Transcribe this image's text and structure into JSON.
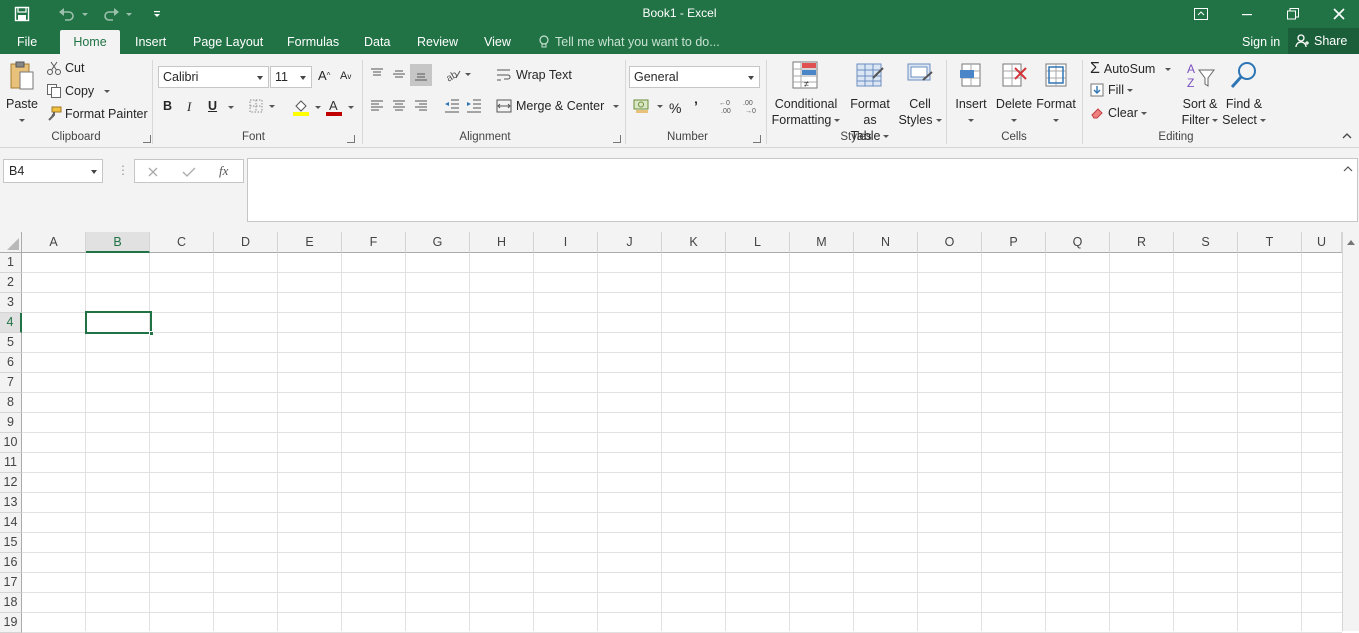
{
  "window": {
    "title": "Book1 - Excel"
  },
  "tabs": [
    "File",
    "Home",
    "Insert",
    "Page Layout",
    "Formulas",
    "Data",
    "Review",
    "View"
  ],
  "active_tab": "Home",
  "tell_me": "Tell me what you want to do...",
  "account": {
    "signin": "Sign in",
    "share": "Share"
  },
  "clipboard": {
    "paste": "Paste",
    "cut": "Cut",
    "copy": "Copy",
    "format_painter": "Format Painter",
    "label": "Clipboard"
  },
  "font": {
    "name": "Calibri",
    "size": "11",
    "bold": "B",
    "italic": "I",
    "underline": "U",
    "label": "Font"
  },
  "alignment": {
    "wrap": "Wrap Text",
    "merge": "Merge & Center",
    "label": "Alignment"
  },
  "number": {
    "format": "General",
    "percent": "%",
    "comma": "’",
    "label": "Number"
  },
  "styles": {
    "cond1": "Conditional",
    "cond2": "Formatting",
    "fat1": "Format as",
    "fat2": "Table",
    "cs1": "Cell",
    "cs2": "Styles",
    "label": "Styles"
  },
  "cells": {
    "insert": "Insert",
    "delete": "Delete",
    "format": "Format",
    "label": "Cells"
  },
  "editing": {
    "autosum": "AutoSum",
    "fill": "Fill",
    "clear": "Clear",
    "sort1": "Sort &",
    "sort2": "Filter",
    "find1": "Find &",
    "find2": "Select",
    "label": "Editing"
  },
  "formula_bar": {
    "namebox": "B4",
    "fx": "fx",
    "value": ""
  },
  "columns": [
    "A",
    "B",
    "C",
    "D",
    "E",
    "F",
    "G",
    "H",
    "I",
    "J",
    "K",
    "L",
    "M",
    "N",
    "O",
    "P",
    "Q",
    "R",
    "S",
    "T",
    "U"
  ],
  "rows": [
    "1",
    "2",
    "3",
    "4",
    "5",
    "6",
    "7",
    "8",
    "9",
    "10",
    "11",
    "12",
    "13",
    "14",
    "15",
    "16",
    "17",
    "18",
    "19"
  ],
  "selected": {
    "column": "B",
    "row": "4"
  },
  "colors": {
    "brand": "#217346",
    "ribbon": "#f3f3f3",
    "gridline": "#e1e1e1"
  }
}
